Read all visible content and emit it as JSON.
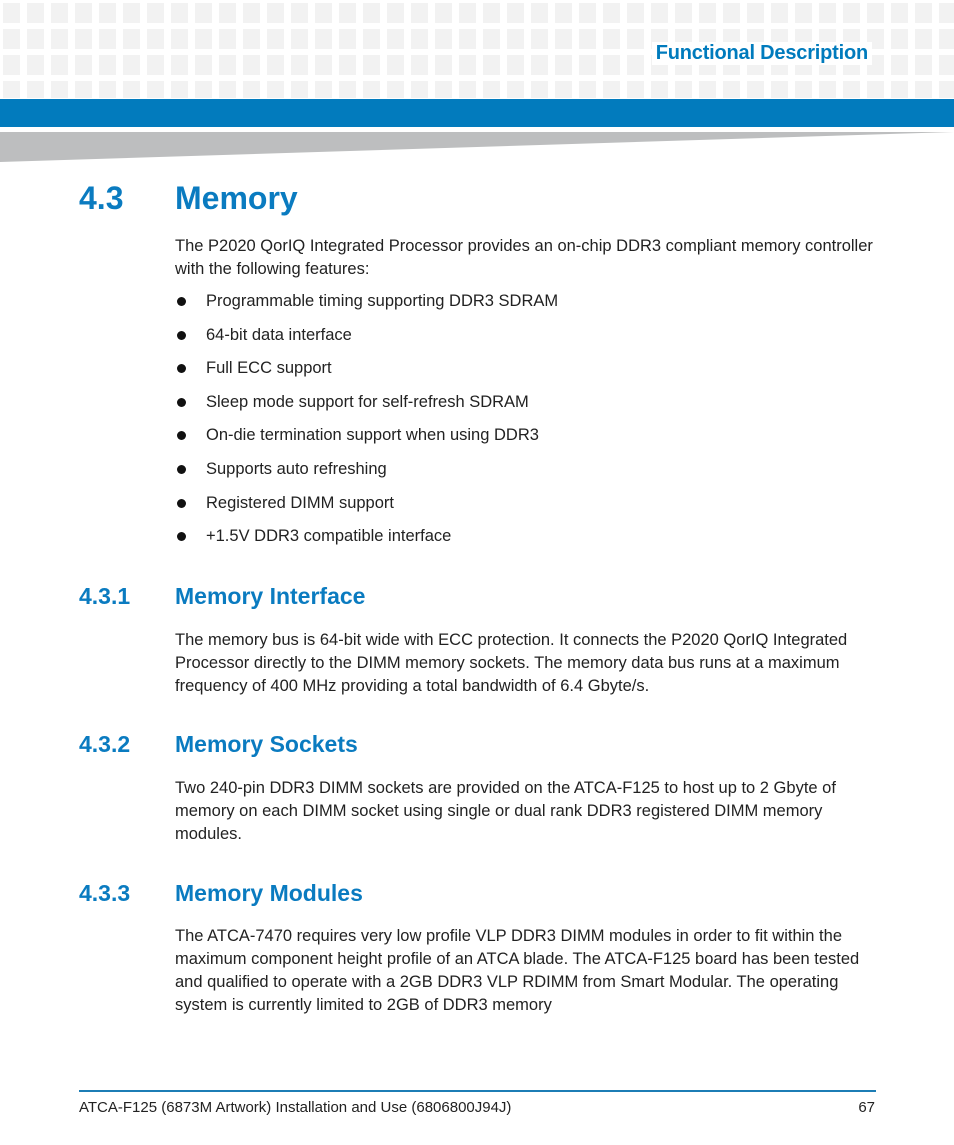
{
  "header": {
    "section_title": "Functional Description"
  },
  "section": {
    "number": "4.3",
    "title": "Memory",
    "intro": "The P2020 QorIQ Integrated Processor provides an on-chip DDR3 compliant memory controller with the following features:",
    "features": [
      "Programmable timing supporting DDR3 SDRAM",
      "64-bit data interface",
      "Full ECC support",
      "Sleep mode support for self-refresh SDRAM",
      "On-die termination support when using DDR3",
      "Supports auto refreshing",
      "Registered DIMM support",
      "+1.5V DDR3 compatible interface"
    ]
  },
  "subsections": [
    {
      "number": "4.3.1",
      "title": "Memory Interface",
      "body": "The memory bus is 64-bit wide with ECC protection. It connects the P2020 QorIQ Integrated Processor directly to the DIMM memory sockets. The memory data bus runs at a maximum frequency of 400 MHz providing a total bandwidth of 6.4 Gbyte/s."
    },
    {
      "number": "4.3.2",
      "title": "Memory Sockets",
      "body": "Two 240-pin DDR3 DIMM sockets are provided on the ATCA-F125 to host up to 2 Gbyte of memory on each DIMM socket using single or dual rank DDR3 registered DIMM memory modules."
    },
    {
      "number": "4.3.3",
      "title": "Memory Modules",
      "body": "The ATCA-7470 requires very low profile VLP DDR3 DIMM modules in order to fit within the maximum component height profile of an ATCA blade. The ATCA-F125 board has been tested and qualified to operate with a 2GB DDR3 VLP RDIMM from Smart Modular. The operating system is currently limited to 2GB of DDR3 memory"
    }
  ],
  "footer": {
    "doc_title": "ATCA-F125 (6873M Artwork) Installation and Use (6806800J94J)",
    "page_number": "67"
  },
  "colors": {
    "accent_blue": "#027bbd",
    "heading_blue": "#0a7bc0"
  }
}
